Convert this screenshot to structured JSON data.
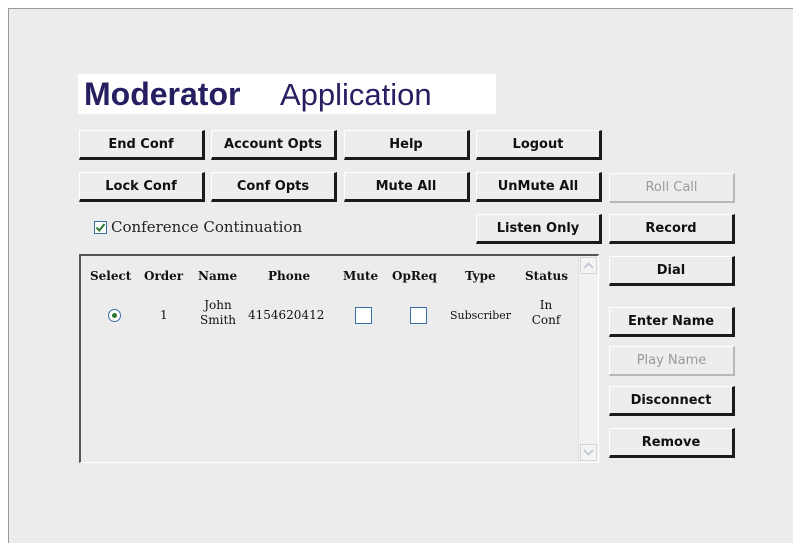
{
  "logo": {
    "bold": "Moderator",
    "light": "Application"
  },
  "buttons": {
    "end_conf": "End Conf",
    "account_opts": "Account Opts",
    "help": "Help",
    "logout": "Logout",
    "lock_conf": "Lock Conf",
    "conf_opts": "Conf Opts",
    "mute_all": "Mute All",
    "unmute_all": "UnMute All",
    "roll_call": "Roll Call",
    "listen_only": "Listen Only",
    "record": "Record",
    "dial": "Dial",
    "enter_name": "Enter Name",
    "play_name": "Play Name",
    "disconnect": "Disconnect",
    "remove": "Remove"
  },
  "conference_continuation": {
    "label": "Conference Continuation",
    "checked": true
  },
  "table": {
    "headers": [
      "Select",
      "Order",
      "Name",
      "Phone",
      "Mute",
      "OpReq",
      "Type",
      "Status"
    ],
    "rows": [
      {
        "selected": true,
        "order": "1",
        "name_first": "John",
        "name_last": "Smith",
        "phone": "4154620412",
        "mute": false,
        "opreq": false,
        "type": "Subscriber",
        "status_line1": "In",
        "status_line2": "Conf"
      }
    ]
  },
  "colors": {
    "logo": "#262062",
    "background": "#ececec",
    "check_accent": "#2b7a2b"
  }
}
